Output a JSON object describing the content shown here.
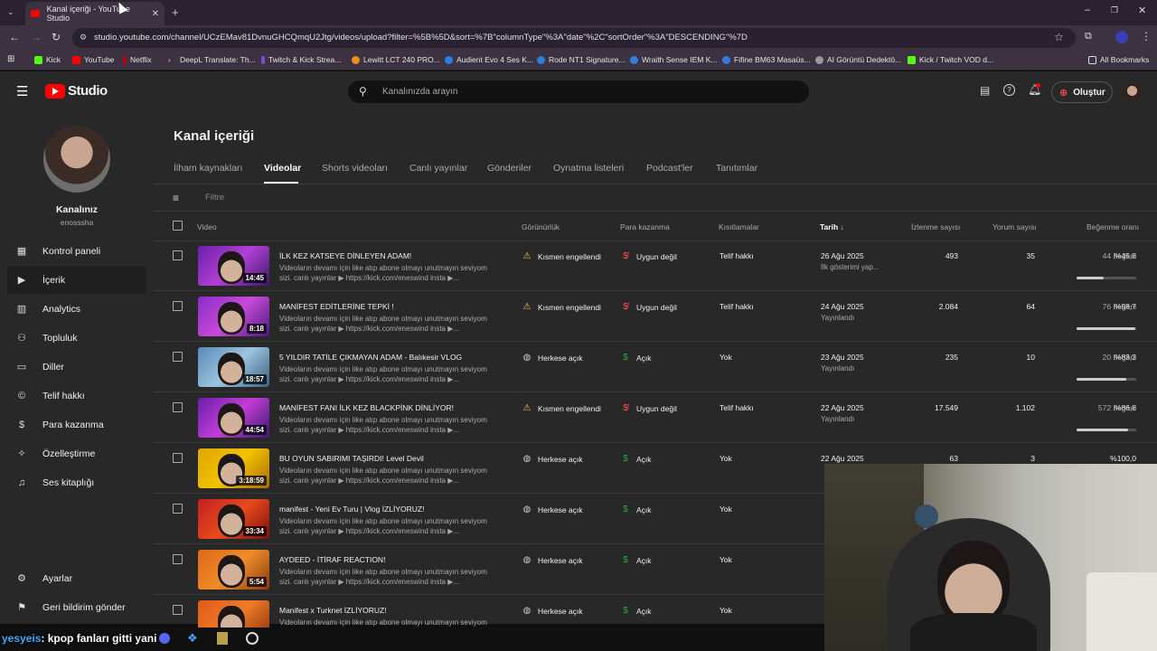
{
  "browser": {
    "tab_title": "Kanal içeriği - YouTube Studio",
    "url": "studio.youtube.com/channel/UCzEMav81DvnuGHCQmqU2Jtg/videos/upload?filter=%5B%5D&sort=%7B\"columnType\"%3A\"date\"%2C\"sortOrder\"%3A\"DESCENDING\"%7D",
    "bookmarks": [
      "Kick",
      "YouTube",
      "Netflix",
      "DeepL Translate: Th...",
      "Twitch & Kick Strea...",
      "Lewitt LCT 240 PRO...",
      "Audient Evo 4 Ses K...",
      "Rode NT1 Signature...",
      "Wraith Sense IEM K...",
      "Fifine BM63 Masaüs...",
      "AI Görüntü Dedektö...",
      "Kick / Twitch VOD d..."
    ],
    "all_bookmarks": "All Bookmarks"
  },
  "header": {
    "logo_text": "Studio",
    "search_placeholder": "Kanalınızda arayın",
    "create_label": "Oluştur"
  },
  "sidebar": {
    "channel_label": "Kanalınız",
    "channel_handle": "enosssha",
    "items": [
      {
        "label": "Kontrol paneli",
        "icon": "dashboard-icon"
      },
      {
        "label": "İçerik",
        "icon": "content-icon"
      },
      {
        "label": "Analytics",
        "icon": "analytics-icon"
      },
      {
        "label": "Topluluk",
        "icon": "community-icon"
      },
      {
        "label": "Diller",
        "icon": "subtitles-icon"
      },
      {
        "label": "Telif hakkı",
        "icon": "copyright-icon"
      },
      {
        "label": "Para kazanma",
        "icon": "dollar-icon"
      },
      {
        "label": "Özelleştirme",
        "icon": "magic-wand-icon"
      },
      {
        "label": "Ses kitaplığı",
        "icon": "audio-library-icon"
      }
    ],
    "settings_label": "Ayarlar",
    "feedback_label": "Geri bildirim gönder"
  },
  "main": {
    "page_title": "Kanal içeriği",
    "tabs": [
      "İlham kaynakları",
      "Videolar",
      "Shorts videoları",
      "Canlı yayınlar",
      "Gönderiler",
      "Oynatma listeleri",
      "Podcast'ler",
      "Tanıtımlar"
    ],
    "active_tab": "Videolar",
    "filter_placeholder": "Filtre",
    "columns": {
      "video": "Video",
      "visibility": "Görünürlük",
      "monetization": "Para kazanma",
      "restrictions": "Kısıtlamalar",
      "date": "Tarih",
      "views": "İzlenme sayısı",
      "comments": "Yorum sayısı",
      "likes": "Beğenme oranı"
    },
    "videos": [
      {
        "title": "İLK KEZ KATSEYE DİNLEYEN ADAM!",
        "desc1": "Videoların devamı için like atıp abone olmayı unutmayın seviyom",
        "desc2": "sizi. canlı yayınlar ▶ https://kick.com/eneswind insta ▶...",
        "duration": "14:45",
        "visibility": "Kısmen engellendi",
        "monetization": "Uygun değil",
        "restrictions": "Telif hakkı",
        "date": "26 Ağu 2025",
        "date_sub": "İlk gösterimi yap...",
        "views": "493",
        "comments": "35",
        "like_pct": "%45,8",
        "likes": "44 beğeni",
        "like_ratio": 0.458
      },
      {
        "title": "MANİFEST EDİTLERİNE TEPKİ !",
        "desc1": "Videoların devamı için like atıp abone olmayı unutmayın seviyom",
        "desc2": "sizi. canlı yayınlar ▶ https://kick.com/eneswind insta ▶...",
        "duration": "8:18",
        "visibility": "Kısmen engellendi",
        "monetization": "Uygun değil",
        "restrictions": "Telif hakkı",
        "date": "24 Ağu 2025",
        "date_sub": "Yayınlandı",
        "views": "2.084",
        "comments": "64",
        "like_pct": "%98,7",
        "likes": "76 beğeni",
        "like_ratio": 0.987
      },
      {
        "title": "5 YILDIR TATİLE ÇIKMAYAN ADAM - Balıkesir VLOG",
        "desc1": "Videoların devamı için like atıp abone olmayı unutmayın seviyom",
        "desc2": "sizi. canlı yayınlar ▶ https://kick.com/eneswind insta ▶...",
        "duration": "18:57",
        "visibility": "Herkese açık",
        "monetization": "Açık",
        "restrictions": "Yok",
        "date": "23 Ağu 2025",
        "date_sub": "Yayınlandı",
        "views": "235",
        "comments": "10",
        "like_pct": "%83,3",
        "likes": "20 beğeni",
        "like_ratio": 0.833
      },
      {
        "title": "MANİFEST FANI İLK KEZ BLACKPİNK DİNLİYOR!",
        "desc1": "Videoların devamı için like atıp abone olmayı unutmayın seviyom",
        "desc2": "sizi. canlı yayınlar ▶ https://kick.com/eneswind insta ▶...",
        "duration": "44:54",
        "visibility": "Kısmen engellendi",
        "monetization": "Uygun değil",
        "restrictions": "Telif hakkı",
        "date": "22 Ağu 2025",
        "date_sub": "Yayınlandı",
        "views": "17.549",
        "comments": "1.102",
        "like_pct": "%86,8",
        "likes": "572 beğeni",
        "like_ratio": 0.868
      },
      {
        "title": "BU OYUN SABIRIMI TAŞIRDI! Level Devil",
        "desc1": "Videoların devamı için like atıp abone olmayı unutmayın seviyom",
        "desc2": "sizi. canlı yayınlar ▶ https://kick.com/eneswind insta ▶...",
        "duration": "3:18:59",
        "visibility": "Herkese açık",
        "monetization": "Açık",
        "restrictions": "Yok",
        "date": "22 Ağu 2025",
        "date_sub": "",
        "views": "63",
        "comments": "3",
        "like_pct": "%100,0",
        "likes": "",
        "like_ratio": 1.0
      },
      {
        "title": "manifest - Yeni Ev Turu | Vlog İZLİYORUZ!",
        "desc1": "Videoların devamı için like atıp abone olmayı unutmayın seviyom",
        "desc2": "sizi. canlı yayınlar ▶ https://kick.com/eneswind insta ▶...",
        "duration": "33:34",
        "visibility": "Herkese açık",
        "monetization": "Açık",
        "restrictions": "Yok",
        "date": "",
        "date_sub": "",
        "views": "",
        "comments": "",
        "like_pct": "",
        "likes": "",
        "like_ratio": null
      },
      {
        "title": "AYDEED - İTİRAF REACTION!",
        "desc1": "Videoların devamı için like atıp abone olmayı unutmayın seviyom",
        "desc2": "sizi. canlı yayınlar ▶ https://kick.com/eneswind insta ▶...",
        "duration": "5:54",
        "visibility": "Herkese açık",
        "monetization": "Açık",
        "restrictions": "Yok",
        "date": "",
        "date_sub": "",
        "views": "",
        "comments": "",
        "like_pct": "",
        "likes": "",
        "like_ratio": null
      },
      {
        "title": "Manifest x Turknet İZLİYORUZ!",
        "desc1": "Videoların devamı için like atıp abone olmayı unutmayın seviyom",
        "desc2": "",
        "duration": "",
        "visibility": "Herkese açık",
        "monetization": "Açık",
        "restrictions": "Yok",
        "date": "",
        "date_sub": "",
        "views": "",
        "comments": "",
        "like_pct": "",
        "likes": "",
        "like_ratio": null
      }
    ]
  },
  "overlay": {
    "caption_user": "yesyeis",
    "caption_text": ": kpop fanları gitti yani"
  },
  "colors": {
    "accent": "#3ea6ff",
    "brand_red": "#ff0000",
    "bg": "#282828"
  }
}
